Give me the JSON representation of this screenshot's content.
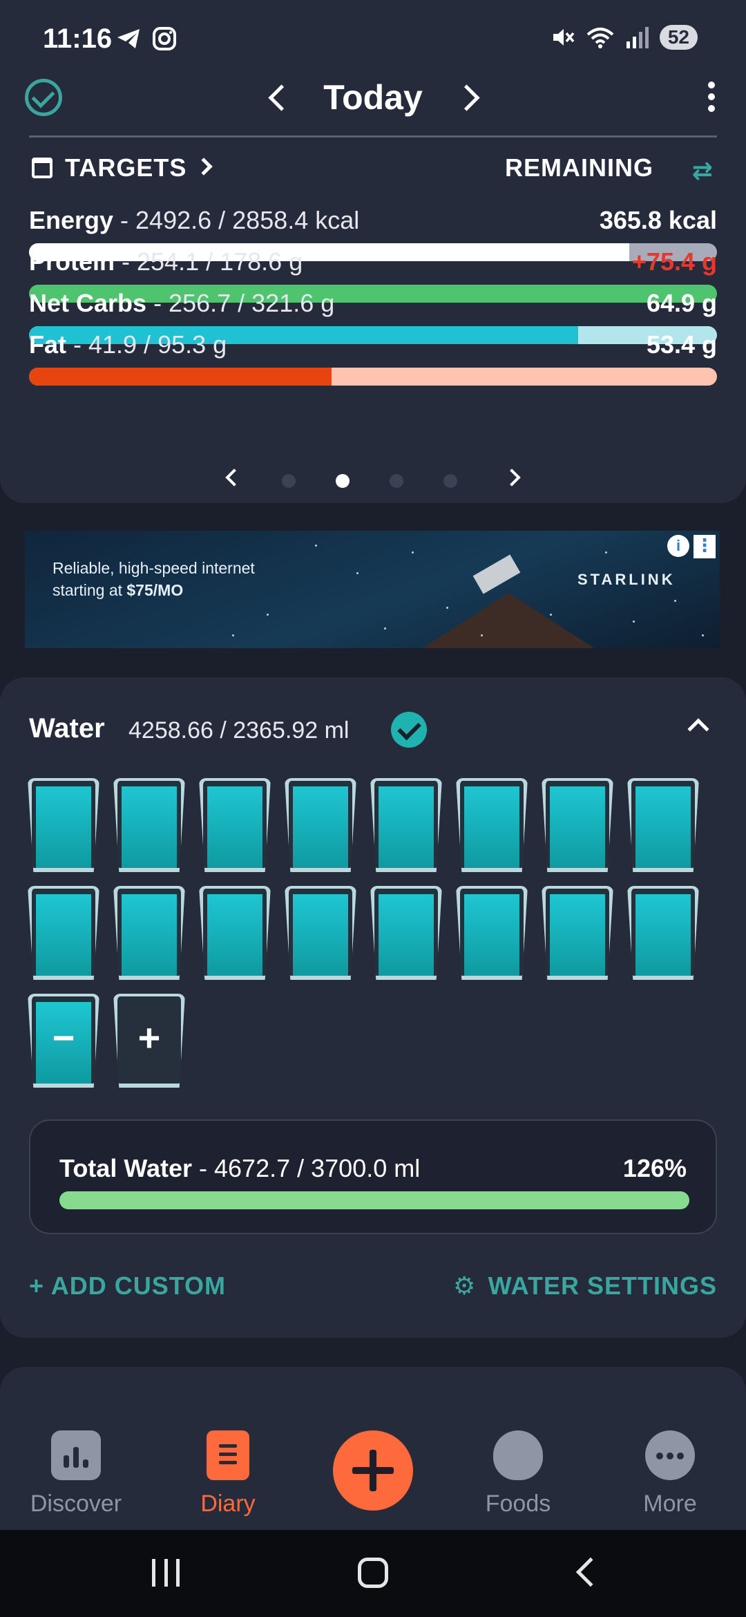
{
  "status_bar": {
    "time": "11:16",
    "battery": "52"
  },
  "header": {
    "title": "Today"
  },
  "targets": {
    "label": "TARGETS",
    "remaining_label": "REMAINING"
  },
  "macros": [
    {
      "name": "Energy",
      "values": " - 2492.6 / 2858.4 kcal",
      "remaining": "365.8 kcal",
      "remaining_color": "#ffffff",
      "fill_fraction": 0.872,
      "fill_color": "#ffffff",
      "track_color": "#a8abb9"
    },
    {
      "name": "Protein",
      "values": " - 254.1 / 178.6 g",
      "remaining": "+75.4 g",
      "remaining_color": "#e8372c",
      "fill_fraction": 1.0,
      "fill_color": "#4fc46f",
      "track_color": "#4fc46f"
    },
    {
      "name": "Net Carbs",
      "values": " - 256.7 / 321.6 g",
      "remaining": "64.9 g",
      "remaining_color": "#ffffff",
      "fill_fraction": 0.798,
      "fill_color": "#1ec2d2",
      "track_color": "#b3e6ec"
    },
    {
      "name": "Fat",
      "values": " - 41.9 / 95.3 g",
      "remaining": "53.4 g",
      "remaining_color": "#ffffff",
      "fill_fraction": 0.44,
      "fill_color": "#e8440f",
      "track_color": "#ffc4b0"
    }
  ],
  "pager": {
    "page_count": 4,
    "active_index": 1
  },
  "ad": {
    "line1": "Reliable, high-speed internet",
    "line2_prefix": "starting at ",
    "line2_price": "$75/MO",
    "brand": "STARLINK"
  },
  "water": {
    "title": "Water",
    "amount": "4258.66 / 2365.92 ml",
    "filled_glasses": 17,
    "minus_symbol": "−",
    "plus_symbol": "+",
    "total_label": "Total Water",
    "total_values": " - 4672.7 / 3700.0 ml",
    "total_percent": "126%",
    "total_fill_fraction": 1.0,
    "add_custom": "ADD CUSTOM",
    "water_settings": "WATER SETTINGS"
  },
  "bottom_nav": {
    "discover": "Discover",
    "diary": "Diary",
    "foods": "Foods",
    "more": "More"
  },
  "colors": {
    "accent": "#3aa6a0",
    "orange": "#ff6a3d",
    "card": "#262b3b",
    "background": "#1b1f2b"
  }
}
